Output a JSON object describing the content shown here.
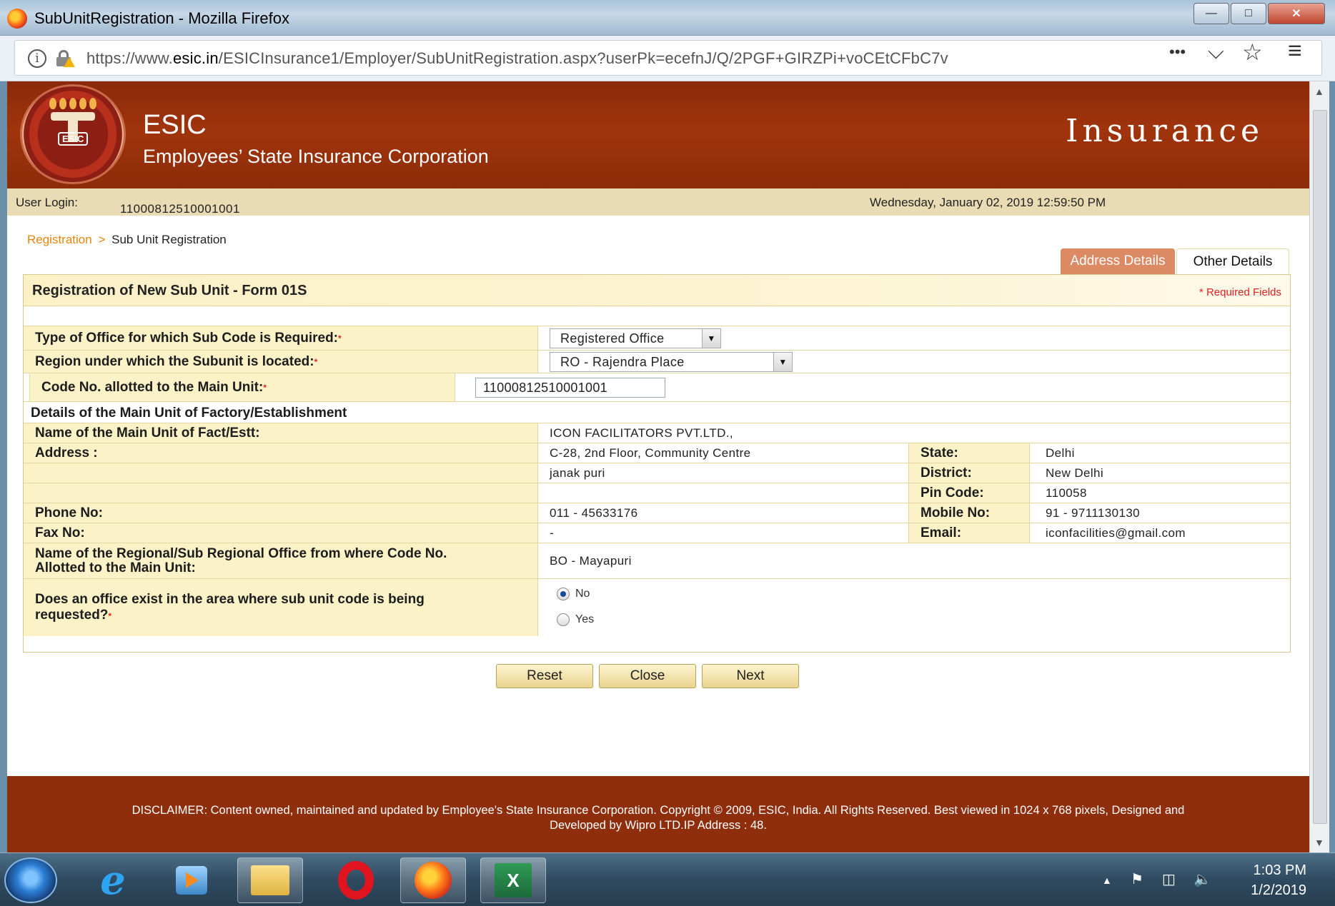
{
  "window": {
    "title": "SubUnitRegistration - Mozilla Firefox",
    "min_label": "—",
    "max_label": "□",
    "close_label": "✕"
  },
  "browser": {
    "url_prefix": "https://www.",
    "url_domain": "esic.in",
    "url_path": "/ESICInsurance1/Employer/SubUnitRegistration.aspx?userPk=ecefnJ/Q/2PGF+GIRZPi+voCEtCFbC7v",
    "menu_dots": "•••",
    "pocket_glyph": "⌵",
    "star_glyph": "☆",
    "hamburger_glyph": "≡"
  },
  "header": {
    "brand_short": "ESIC",
    "brand_full": "Employees’ State Insurance Corporation",
    "section": "Insurance",
    "emblem_text": "ESIC"
  },
  "userbar": {
    "login_label": "User Login:",
    "login_value": "11000812510001001",
    "datetime": "Wednesday, January 02, 2019 12:59:50 PM"
  },
  "breadcrumb": {
    "parent": "Registration",
    "separator": ">",
    "current": "Sub Unit Registration"
  },
  "tabs": {
    "address": "Address Details",
    "other": "Other Details"
  },
  "form": {
    "title": "Registration of New Sub Unit - Form 01S",
    "required_note": "* Required Fields",
    "required_mark": "*",
    "office_type_label": "Type of Office for which Sub Code is Required:",
    "office_type_value": "Registered Office",
    "region_label": "Region under which the Subunit is located:",
    "region_value": "RO - Rajendra Place",
    "code_label": "Code No. allotted to the Main Unit:",
    "code_value": "11000812510001001",
    "details_heading": "Details of the Main Unit of Factory/Establishment",
    "name_label": "Name of the Main Unit of Fact/Estt:",
    "name_value": "ICON FACILITATORS PVT.LTD.,",
    "address_label": "Address :",
    "address_line1": "C-28, 2nd Floor, Community Centre",
    "address_line2": "janak puri",
    "state_label": "State:",
    "state_value": "Delhi",
    "district_label": "District:",
    "district_value": "New Delhi",
    "pin_label": "Pin Code:",
    "pin_value": "110058",
    "phone_label": "Phone No:",
    "phone_value": "011 - 45633176",
    "mobile_label": "Mobile No:",
    "mobile_value": "91 - 9711130130",
    "fax_label": "Fax No:",
    "fax_value": "-",
    "email_label": "Email:",
    "email_value": "iconfacilities@gmail.com",
    "regional_office_label_1": "Name of the Regional/Sub Regional Office from where Code No.",
    "regional_office_label_2": "Allotted to the Main Unit:",
    "regional_office_value": "BO - Mayapuri",
    "office_exists_label_1": "Does an office exist in the area where sub unit code is being",
    "office_exists_label_2": "requested?",
    "radio_no": "No",
    "radio_yes": "Yes",
    "radio_selected": "No"
  },
  "buttons": {
    "reset": "Reset",
    "close": "Close",
    "next": "Next"
  },
  "footer": {
    "disclaimer_1": "DISCLAIMER: Content owned, maintained and updated by Employee's State Insurance Corporation. Copyright © 2009, ESIC, India. All Rights Reserved. Best viewed in 1024 x 768 pixels, Designed and",
    "disclaimer_2": "Developed by Wipro LTD.IP Address : 48."
  },
  "taskbar": {
    "excel_glyph": "X",
    "ie_glyph": "e",
    "tray_arrow": "▲",
    "clock_time": "1:03 PM",
    "clock_date": "1/2/2019"
  },
  "icons": [
    "firefox-icon",
    "info-icon",
    "lock-warning-icon",
    "more-icon",
    "pocket-icon",
    "bookmark-star-icon",
    "menu-icon",
    "esic-emblem",
    "dropdown-arrow-icon",
    "windows-start-icon",
    "ie-icon",
    "media-player-icon",
    "file-explorer-icon",
    "opera-icon",
    "excel-icon",
    "flag-icon",
    "network-icon",
    "volume-icon"
  ],
  "colors": {
    "banner": "#9a320c",
    "userbar": "#e9dcb4",
    "label_bg": "#fbf2c8",
    "accent_tab": "#dc8a64",
    "breadcrumb_link": "#e4860c",
    "required": "#e02020"
  }
}
